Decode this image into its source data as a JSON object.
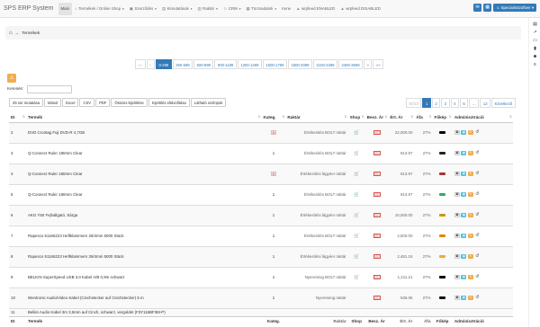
{
  "brand": "SPS ERP System",
  "nav": {
    "items": [
      {
        "label": "Main",
        "active": true
      },
      {
        "label": "Termékek / Online Shop",
        "icon": "⌂",
        "caret": true
      },
      {
        "label": "Szerződés",
        "icon": "▣",
        "caret": true
      },
      {
        "label": "Kimutatások",
        "icon": "▤",
        "caret": true
      },
      {
        "label": "Raktár",
        "icon": "▥",
        "caret": true
      },
      {
        "label": "CRM",
        "icon": "☺",
        "caret": true
      },
      {
        "label": "Törzsadatok",
        "icon": "▦",
        "caret": true
      },
      {
        "label": "Irene",
        "icon": "",
        "caret": false
      },
      {
        "label": "wrpfeed ENABLED",
        "icon": "▲",
        "caret": false
      },
      {
        "label": "wrpfeed DISABLED",
        "icon": "▲",
        "caret": false
      }
    ],
    "user": "SpecialisSzoftver"
  },
  "breadcrumb": {
    "current": "Termékek"
  },
  "pagination_top": {
    "first": "««",
    "prev": "«",
    "pages": [
      "0-299",
      "300-599",
      "600-899",
      "900-1199",
      "1200-1499",
      "1500-1799",
      "1800-2099",
      "2100-2399",
      "2400-2699"
    ],
    "next": "»",
    "last": "»»"
  },
  "search": {
    "label": "Keresés:",
    "value": ""
  },
  "toolbar": [
    "25 sor mutatása",
    "Másol",
    "Excel",
    "CSV",
    "PDF",
    "Összes kijelölése",
    "Kijelölés eltávolítása",
    "Látható oszlopok"
  ],
  "pagination_table": {
    "prev": "Előző",
    "pages": [
      "1",
      "2",
      "3",
      "4",
      "5",
      "…",
      "12"
    ],
    "next": "Következő"
  },
  "columns": [
    "ID",
    "Termék",
    "Kateg.",
    "Raktár",
    "Shop",
    "Besz. Ár",
    "Ért. Ár",
    "Áfa",
    "Főkép",
    "Adminisztráció"
  ],
  "rows": [
    {
      "id": "2",
      "name": "DVD Crontag Fuji DVD-R 4,7GB",
      "kat": "#",
      "raktar": "Értékesítés BOLT raktár",
      "shop": true,
      "besz": "☐",
      "ert": "22,000.00",
      "afa": "27%",
      "color": "#000"
    },
    {
      "id": "3",
      "name": "Q-Connect Ruler 180mm Clear",
      "kat": "1",
      "raktar": "Értékesítés BOLT raktár",
      "shop": true,
      "besz": "☐",
      "ert": "913.97",
      "afa": "27%",
      "color": "#222"
    },
    {
      "id": "4",
      "name": "Q-Connect Ruler 180mm Clear",
      "kat": "#",
      "raktar": "Értékesítési lágyéer raktár",
      "shop": true,
      "besz": "☐",
      "ert": "913.97",
      "afa": "27%",
      "color": "#a33"
    },
    {
      "id": "5",
      "name": "Q-Connect Ruler 180mm Clear",
      "kat": "1",
      "raktar": "Értékesítés BOLT raktár",
      "shop": true,
      "besz": "☐",
      "ert": "913.97",
      "afa": "27%",
      "color": "#3a6"
    },
    {
      "id": "6",
      "name": "AKG Y50 Fejhallgató, Sárga",
      "kat": "1",
      "raktar": "Értékesítési lágyéer raktár",
      "shop": true,
      "besz": "☐",
      "ert": "10,000.00",
      "afa": "27%",
      "color": "#c90"
    },
    {
      "id": "7",
      "name": "Rapesco 51166223 Heftklammern 26/4mm 5000 Stück",
      "kat": "1",
      "raktar": "Értékesítés BOLT raktár",
      "shop": true,
      "besz": "☐",
      "ert": "2,500.00",
      "afa": "27%",
      "color": "#d80"
    },
    {
      "id": "8",
      "name": "Rapesco 51166223 Heftklammern 26/4mm 5000 Stück",
      "kat": "1",
      "raktar": "Értékesítési lágyéer raktár",
      "shop": true,
      "besz": "☐",
      "ert": "2,481.16",
      "afa": "27%",
      "color": "#ea3"
    },
    {
      "id": "9",
      "name": "BELKIN SuperSpeed USB 3.0 Kabel A/B 0,9m schwarz",
      "kat": "1",
      "raktar": "Nyereséog BOLT raktár",
      "shop": true,
      "besz": "☐",
      "ert": "1,211.21",
      "afa": "27%",
      "color": "#000"
    },
    {
      "id": "10",
      "name": "Wentronic Audio/Video Kabel (Cinchstecker auf Cinchstecker) 5 m",
      "kat": "1",
      "raktar": "Nyereséog raktár",
      "shop": false,
      "besz": "☐",
      "ert": "536.06",
      "afa": "27%",
      "color": "#111"
    }
  ],
  "partial_row": {
    "id": "11",
    "name": "Belkin Audio Kabel 3m 3,5mm auf Cinch, schwarz, vergoldet (F3Y116BF3M-P)"
  },
  "side_icons": [
    "book-icon",
    "chart-icon",
    "monitor-icon",
    "briefcase-icon",
    "users-icon",
    "server-icon"
  ]
}
